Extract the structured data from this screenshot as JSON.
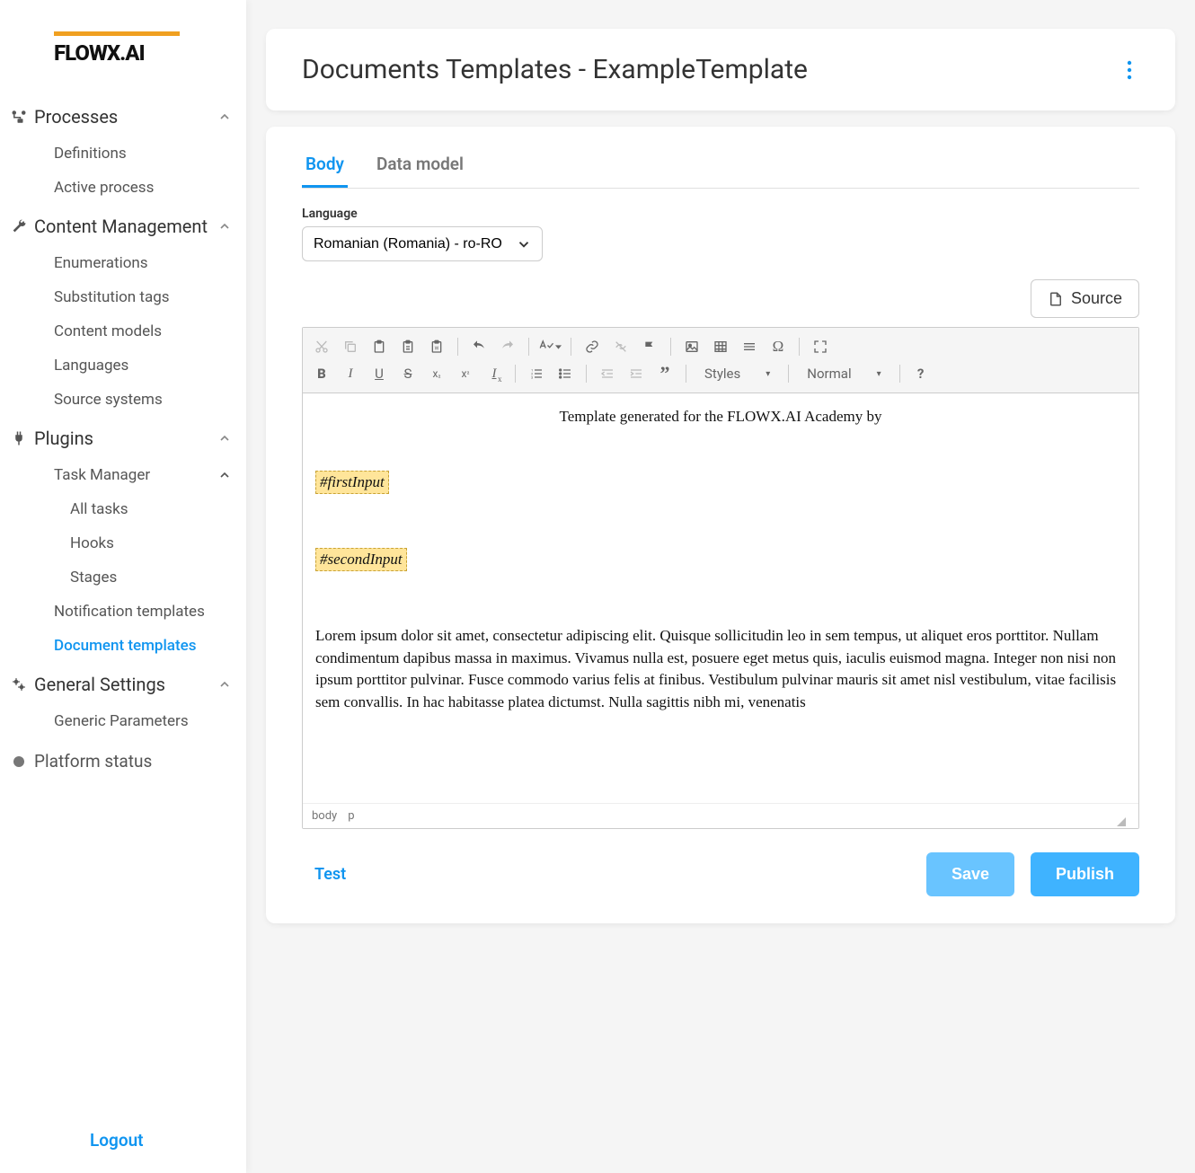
{
  "brand": "FLOWX.AI",
  "sidebar": {
    "logout": "Logout",
    "platform_status": "Platform status",
    "groups": [
      {
        "label": "Processes",
        "items": [
          {
            "label": "Definitions"
          },
          {
            "label": "Active process"
          }
        ]
      },
      {
        "label": "Content Management",
        "items": [
          {
            "label": "Enumerations"
          },
          {
            "label": "Substitution tags"
          },
          {
            "label": "Content models"
          },
          {
            "label": "Languages"
          },
          {
            "label": "Source systems"
          }
        ]
      },
      {
        "label": "Plugins",
        "subgroups": [
          {
            "label": "Task Manager",
            "items": [
              {
                "label": "All tasks"
              },
              {
                "label": "Hooks"
              },
              {
                "label": "Stages"
              }
            ]
          }
        ],
        "items": [
          {
            "label": "Notification templates"
          },
          {
            "label": "Document templates",
            "active": true
          }
        ]
      },
      {
        "label": "General Settings",
        "items": [
          {
            "label": "Generic Parameters"
          }
        ]
      }
    ]
  },
  "header": {
    "title": "Documents Templates - ExampleTemplate"
  },
  "tabs": {
    "body": "Body",
    "data_model": "Data model"
  },
  "language": {
    "label": "Language",
    "value": "Romanian (Romania) - ro-RO"
  },
  "source_button": "Source",
  "editor": {
    "styles_label": "Styles",
    "format_label": "Normal",
    "content": {
      "center_line": "Template generated for the FLOWX.AI Academy by",
      "token1": "#firstInput",
      "token2": "#secondInput",
      "para": "Lorem ipsum dolor sit amet, consectetur adipiscing elit. Quisque sollicitudin leo in sem tempus, ut aliquet eros porttitor. Nullam condimentum dapibus massa in maximus. Vivamus nulla est, posuere eget metus quis, iaculis euismod magna. Integer non nisi non ipsum porttitor pulvinar. Fusce commodo varius felis at finibus. Vestibulum pulvinar mauris sit amet nisl vestibulum, vitae facilisis sem convallis. In hac habitasse platea dictumst. Nulla sagittis nibh mi, venenatis"
    },
    "status_path": [
      "body",
      "p"
    ]
  },
  "actions": {
    "test": "Test",
    "save": "Save",
    "publish": "Publish"
  }
}
